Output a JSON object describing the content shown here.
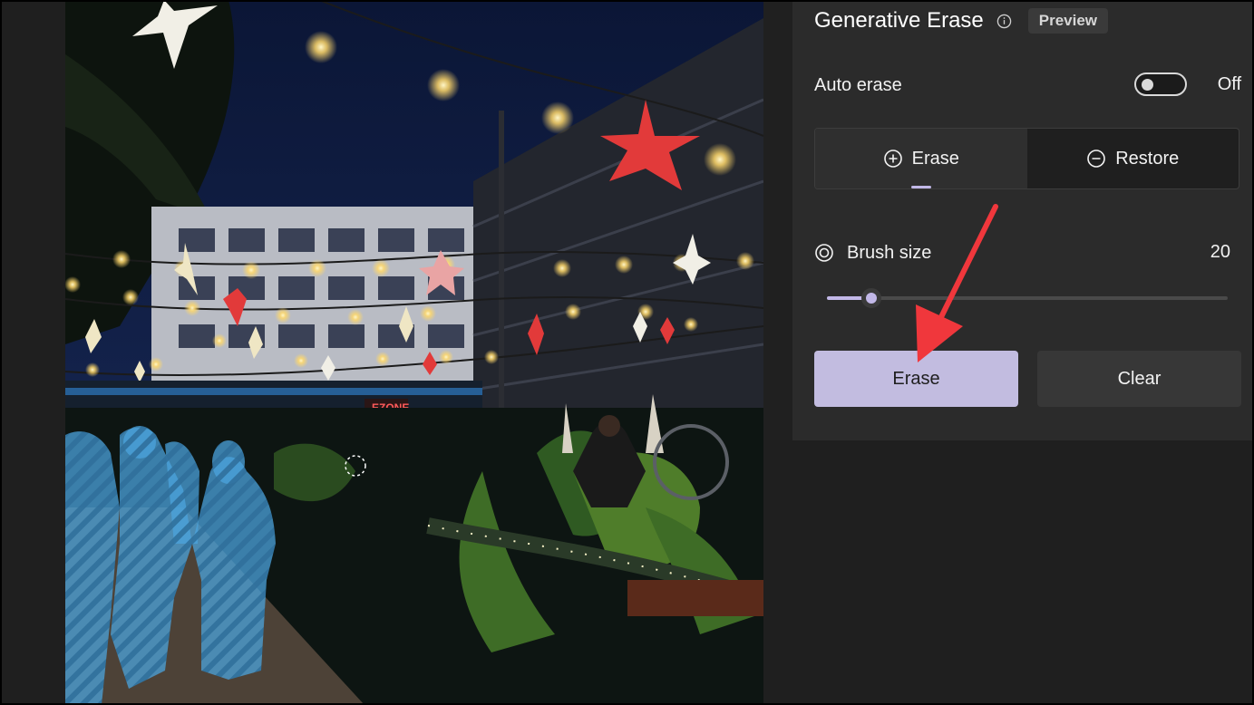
{
  "panel": {
    "title": "Generative Erase",
    "info_icon": "info-icon",
    "badge": "Preview",
    "auto_erase": {
      "label": "Auto erase",
      "state": "Off",
      "enabled": false
    },
    "modes": [
      {
        "label": "Erase",
        "icon": "plus-circle-icon",
        "active": true
      },
      {
        "label": "Restore",
        "icon": "minus-circle-icon",
        "active": false
      }
    ],
    "brush": {
      "label": "Brush size",
      "icon": "brush-target-icon",
      "value": "20",
      "fraction": 0.11
    },
    "erase_button": "Erase",
    "clear_button": "Clear"
  },
  "photo": {
    "sign_text": "EZONE",
    "description_icon": "night-courtyard-photo"
  },
  "colors": {
    "accent": "#c2b8e8",
    "erase_button": "#c2bce0",
    "panel_bg": "#2b2b2b",
    "annotation_arrow": "#f0373c",
    "selection_overlay": "#4aa3dc"
  }
}
